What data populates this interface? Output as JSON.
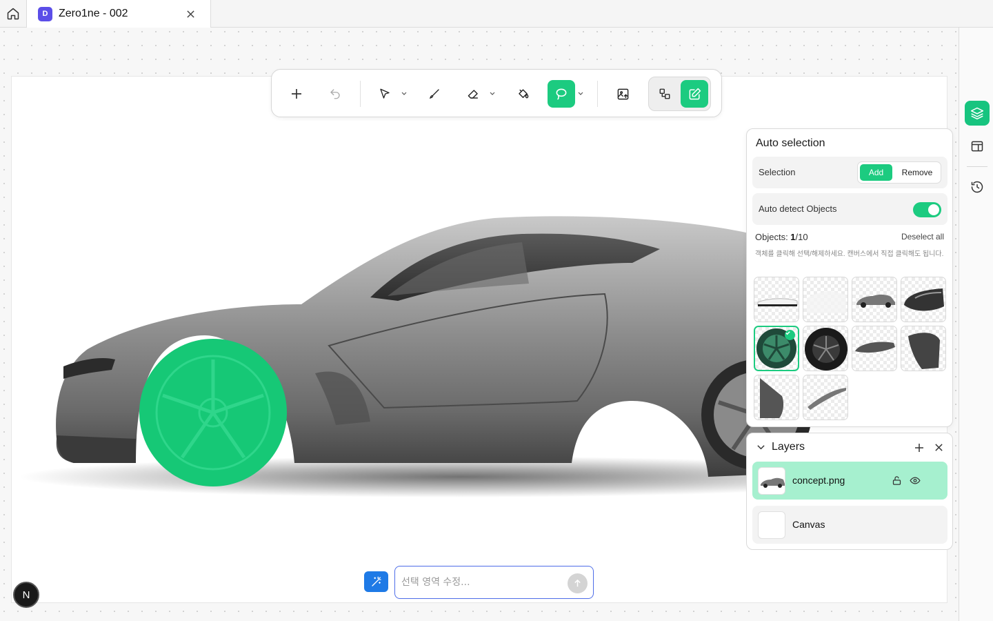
{
  "tabbar": {
    "home_icon": "home-icon",
    "tab": {
      "badge": "D",
      "title": "Zero1ne - 002",
      "close_icon": "close-icon"
    }
  },
  "toolbar": {
    "tools": [
      "add-icon",
      "undo-icon",
      "select-arrow-icon",
      "brush-icon",
      "eraser-icon",
      "paint-bucket-icon",
      "lasso-icon",
      "image-upload-icon",
      "shapes-icon",
      "edit-icon"
    ],
    "active_tool": "lasso-icon",
    "accent": "#1ccb80"
  },
  "auto_selection": {
    "title": "Auto selection",
    "selection_label": "Selection",
    "add_label": "Add",
    "remove_label": "Remove",
    "auto_detect_label": "Auto detect Objects",
    "auto_detect_on": true,
    "objects_prefix": "Objects: ",
    "objects_selected": "1",
    "objects_total": "/10",
    "deselect_all": "Deselect all",
    "hint": "객체를 클릭해 선택/해제하세요. 캔버스에서 직접 클릭해도 됩니다.",
    "thumbnails": [
      "body-outline",
      "glass-area",
      "full-car",
      "front-panel",
      "wheel",
      "tire",
      "side-skirt",
      "fender",
      "door-panel",
      "trim-strip"
    ],
    "selected_thumbnail": "wheel"
  },
  "layers": {
    "title": "Layers",
    "items": [
      {
        "name": "concept.png",
        "active": true
      },
      {
        "name": "Canvas",
        "active": false
      }
    ]
  },
  "prompt": {
    "placeholder": "선택 영역 수정...",
    "value": ""
  },
  "user_badge": "N",
  "right_rail": [
    "layers-icon",
    "layout-panel-icon",
    "history-icon"
  ]
}
